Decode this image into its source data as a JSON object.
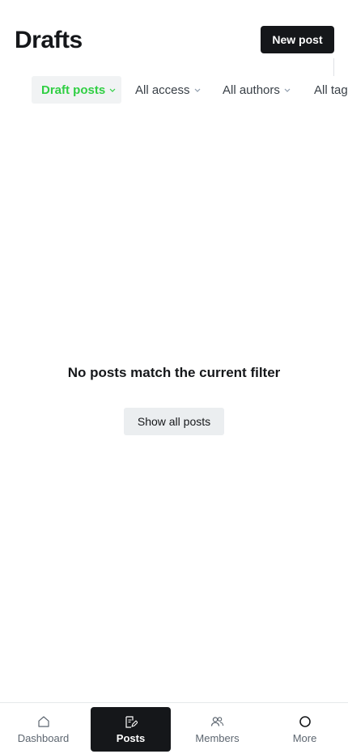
{
  "header": {
    "title": "Drafts",
    "new_post_label": "New post"
  },
  "filters": {
    "type": "Draft posts",
    "access": "All access",
    "authors": "All authors",
    "tags": "All tags"
  },
  "empty_state": {
    "message": "No posts match the current filter",
    "show_all_label": "Show all posts"
  },
  "tabbar": {
    "items": [
      {
        "label": "Dashboard",
        "icon": "home-icon"
      },
      {
        "label": "Posts",
        "icon": "edit-icon",
        "active": true
      },
      {
        "label": "Members",
        "icon": "users-icon"
      },
      {
        "label": "More",
        "icon": "circle-icon"
      }
    ]
  },
  "colors": {
    "accent_green": "#30cf43",
    "dark": "#15171a"
  }
}
